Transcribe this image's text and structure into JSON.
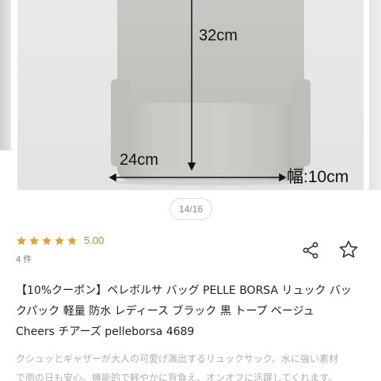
{
  "gallery": {
    "dimension_height": "32cm",
    "dimension_width": "24cm",
    "dimension_depth": "幅:10cm",
    "pager": "14/16"
  },
  "product": {
    "rating_value": "5.00",
    "rating_stars": 5,
    "review_count": "4 件",
    "title_line1": "【10%クーポン】ペレボルサ バッグ PELLE BORSA リュック バッ",
    "title_line2": "クパック 軽量 防水 レディース ブラック 黒 トープ ベージュ",
    "title_line3": "Cheers チアーズ pelleborsa 4689",
    "desc_line1": "クシュッとギャザーが大人の可愛げ演出するリュックサック。水に強い素材",
    "desc_line2": "で雨の日も安心。機能的で軽やかに背負え、オンオフに活躍してくれます。"
  },
  "colors": {
    "star": "#e0a23a",
    "rating_text": "#b98a2e",
    "icon": "#333333"
  },
  "icons": {
    "share": "share-icon",
    "favorite": "star-outline-icon"
  }
}
